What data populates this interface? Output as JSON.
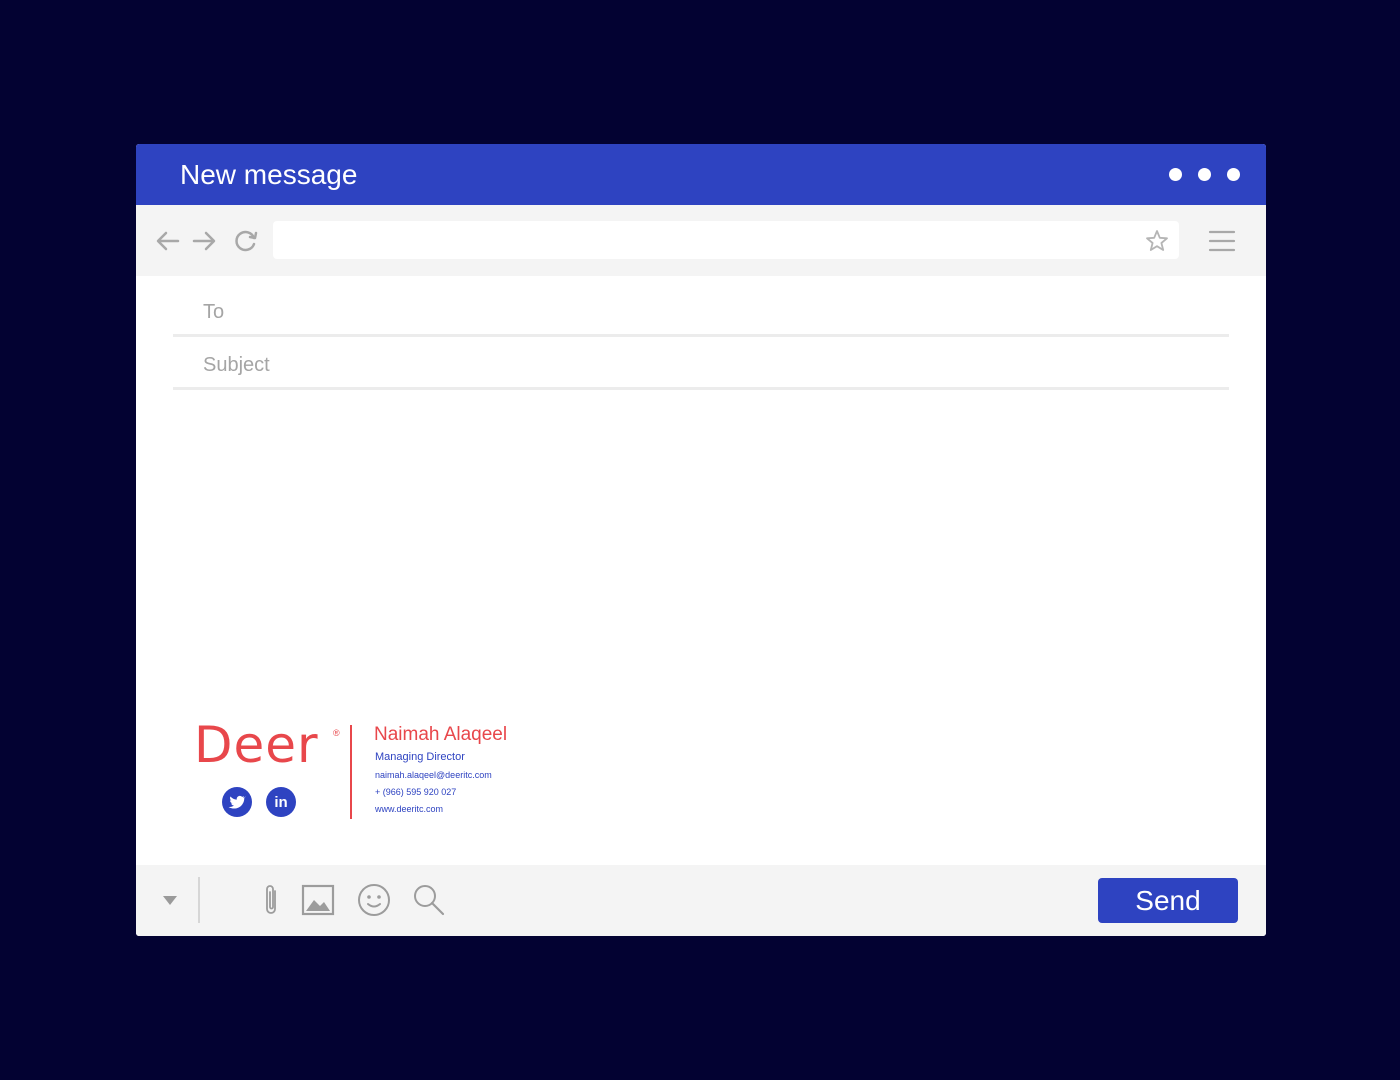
{
  "window": {
    "title": "New message"
  },
  "browser": {
    "url_value": "",
    "icons": [
      "back-arrow-icon",
      "forward-arrow-icon",
      "refresh-icon",
      "star-icon",
      "hamburger-menu-icon"
    ]
  },
  "compose": {
    "to_placeholder": "To",
    "subject_placeholder": "Subject"
  },
  "signature": {
    "logo_text": "Deer",
    "logo_mark": "®",
    "name": "Naimah Alaqeel",
    "role": "Managing Director",
    "email": "naimah.alaqeel@deeritc.com",
    "phone": "+ (966) 595 920 027",
    "website": "www.deeritc.com",
    "social": [
      "twitter-icon",
      "linkedin-icon"
    ],
    "linkedin_label": "in"
  },
  "toolbar": {
    "icons": [
      "caret-down-icon",
      "paperclip-icon",
      "image-icon",
      "smiley-icon",
      "search-icon"
    ],
    "send_label": "Send"
  },
  "colors": {
    "background": "#030232",
    "accent": "#2e43c1",
    "brand_red": "#e8474b",
    "bar_gray": "#f4f4f4"
  }
}
